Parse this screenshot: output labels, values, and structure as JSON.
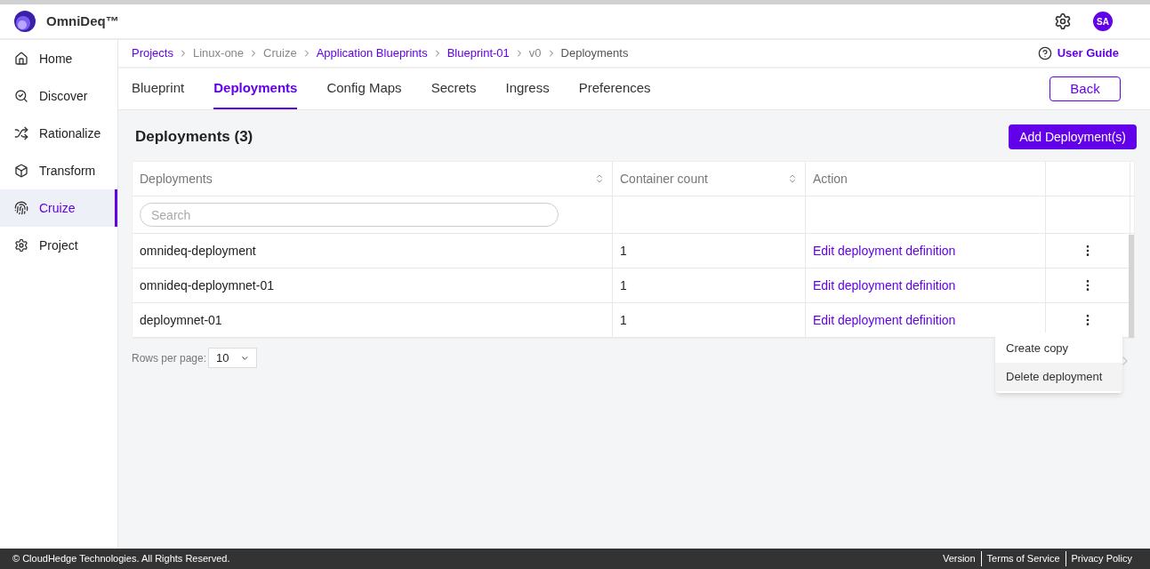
{
  "header": {
    "brand": "OmniDeq™",
    "avatar": "SA"
  },
  "sidebar": {
    "items": [
      {
        "label": "Home",
        "selected": false
      },
      {
        "label": "Discover",
        "selected": false
      },
      {
        "label": "Rationalize",
        "selected": false
      },
      {
        "label": "Transform",
        "selected": false
      },
      {
        "label": "Cruize",
        "selected": true
      },
      {
        "label": "Project",
        "selected": false
      }
    ]
  },
  "breadcrumb": [
    {
      "label": "Projects",
      "link": true,
      "current": false
    },
    {
      "label": "Linux-one",
      "link": false,
      "current": false
    },
    {
      "label": "Cruize",
      "link": false,
      "current": false
    },
    {
      "label": "Application Blueprints",
      "link": true,
      "current": false
    },
    {
      "label": "Blueprint-01",
      "link": true,
      "current": false
    },
    {
      "label": "v0",
      "link": false,
      "current": false
    },
    {
      "label": "Deployments",
      "link": false,
      "current": true
    }
  ],
  "user_guide": "User Guide",
  "tabs": [
    {
      "label": "Blueprint",
      "selected": false
    },
    {
      "label": "Deployments",
      "selected": true
    },
    {
      "label": "Config Maps",
      "selected": false
    },
    {
      "label": "Secrets",
      "selected": false
    },
    {
      "label": "Ingress",
      "selected": false
    },
    {
      "label": "Preferences",
      "selected": false
    }
  ],
  "back_button": "Back",
  "section": {
    "title": "Deployments (3)",
    "add_button": "Add Deployment(s)"
  },
  "table": {
    "columns": [
      {
        "label": "Deployments",
        "sortable": true
      },
      {
        "label": "Container count",
        "sortable": true
      },
      {
        "label": "Action",
        "sortable": false
      }
    ],
    "search": {
      "placeholder": "Search"
    },
    "rows": [
      {
        "name": "omnideq-deployment",
        "count": "1",
        "action": "Edit deployment definition"
      },
      {
        "name": "omnideq-deploymnet-01",
        "count": "1",
        "action": "Edit deployment definition"
      },
      {
        "name": "deploymnet-01",
        "count": "1",
        "action": "Edit deployment definition"
      }
    ]
  },
  "pagination": {
    "label": "Rows per page:",
    "value": "10"
  },
  "menu": {
    "items": [
      {
        "label": "Create copy",
        "highlighted": false
      },
      {
        "label": "Delete deployment",
        "highlighted": true
      }
    ]
  },
  "footer": {
    "copyright": "© CloudHedge Technologies. All Rights Reserved.",
    "links": [
      "Version",
      "Terms of Service",
      "Privacy Policy"
    ]
  }
}
